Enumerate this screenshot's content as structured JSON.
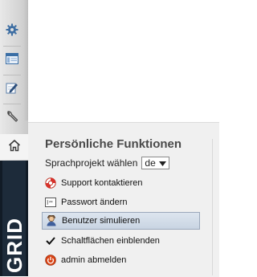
{
  "sidebar": {
    "icons": [
      "gear-icon",
      "window-icon",
      "edit-icon",
      "wrench-icon"
    ],
    "home_icon": "home-icon",
    "brand": "GRID"
  },
  "menu": {
    "title": "Persönliche Funktionen",
    "language_label": "Sprachprojekt wählen",
    "language_value": "de",
    "items": [
      {
        "label": "Support kontaktieren",
        "icon": "lifebuoy-icon"
      },
      {
        "label": "Passwort ändern",
        "icon": "password-field-icon"
      },
      {
        "label": "Benutzer simulieren",
        "icon": "user-icon",
        "active": true
      },
      {
        "label": "Schaltflächen einblenden",
        "icon": "checkmark-icon"
      },
      {
        "label": "admin abmelden",
        "icon": "power-icon"
      }
    ]
  }
}
